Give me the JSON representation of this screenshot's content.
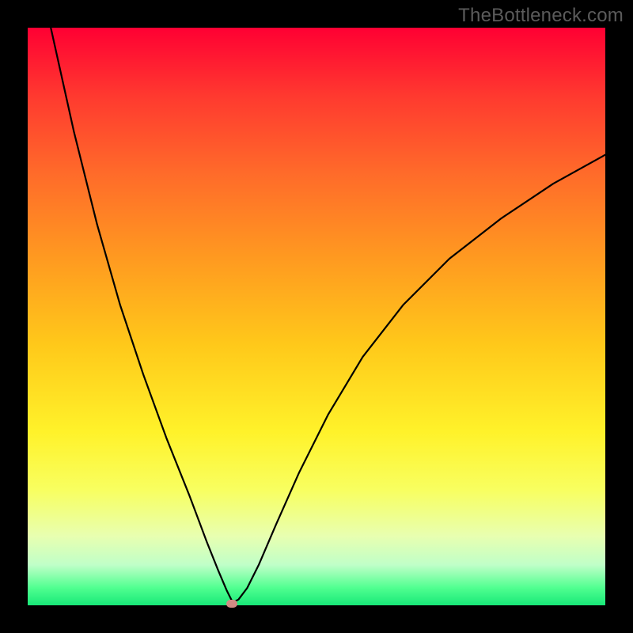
{
  "watermark": "TheBottleneck.com",
  "chart_data": {
    "type": "line",
    "title": "",
    "xlabel": "",
    "ylabel": "",
    "xlim": [
      0,
      100
    ],
    "ylim": [
      0,
      100
    ],
    "series": [
      {
        "name": "curve",
        "x": [
          4,
          8,
          12,
          16,
          20,
          24,
          28,
          31,
          33,
          34.5,
          35.5,
          36.5,
          38,
          40,
          43,
          47,
          52,
          58,
          65,
          73,
          82,
          91,
          100
        ],
        "y": [
          100,
          82,
          66,
          52,
          40,
          29,
          19,
          11,
          6,
          2.5,
          0.5,
          1,
          3,
          7,
          14,
          23,
          33,
          43,
          52,
          60,
          67,
          73,
          78
        ]
      }
    ],
    "marker": {
      "x": 35.3,
      "y": 0.3,
      "color": "#d18b84"
    },
    "background_gradient": [
      "#ff0033",
      "#ff6a2a",
      "#ffc91a",
      "#f8ff60",
      "#50ff90",
      "#18e878"
    ]
  }
}
